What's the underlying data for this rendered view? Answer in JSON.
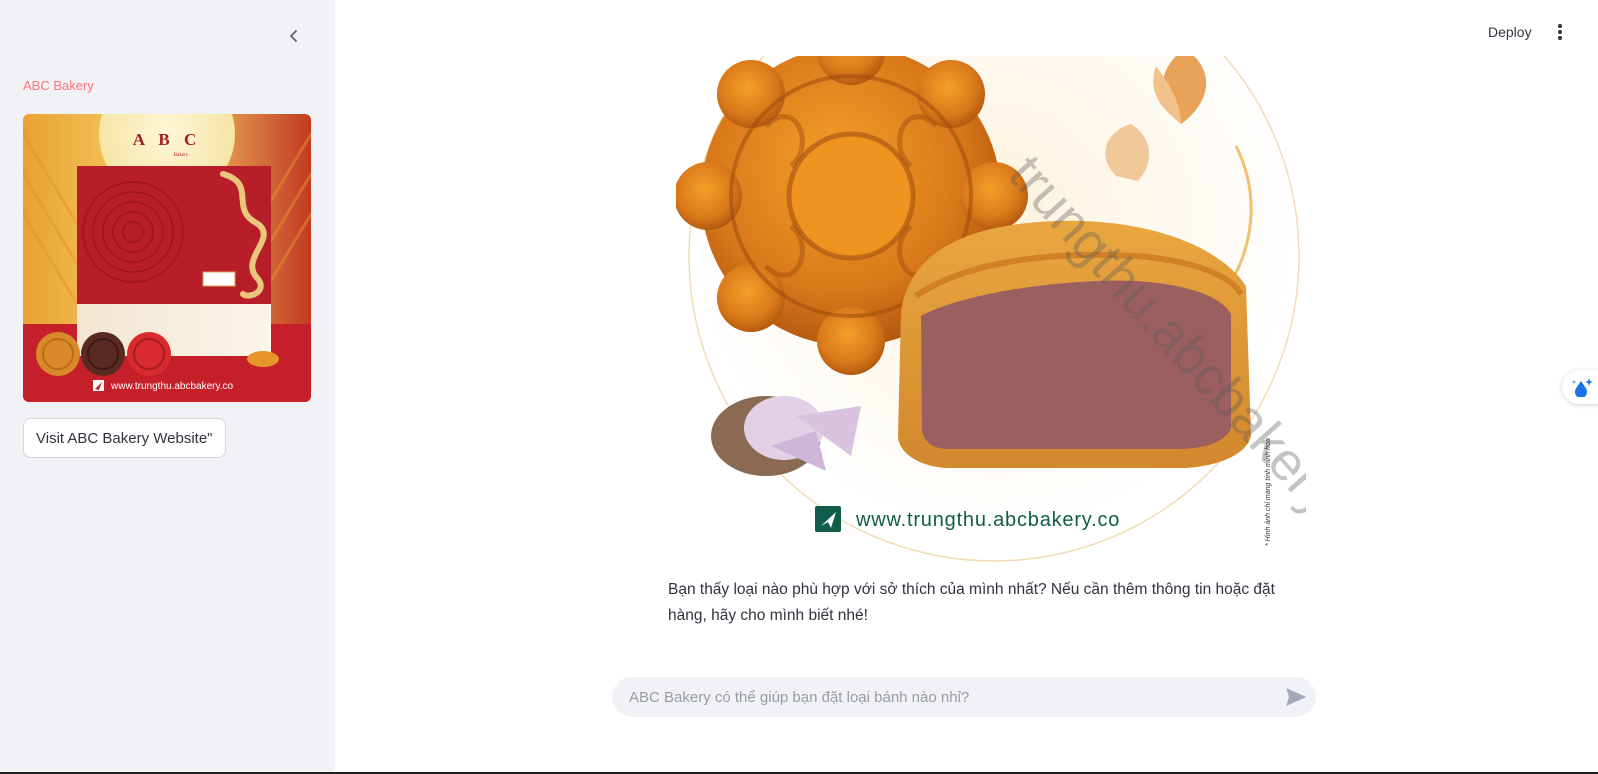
{
  "sidebar": {
    "brand": "ABC Bakery",
    "promo_image": {
      "logo_text": "A B C",
      "logo_sub": "Bakery",
      "url_text": "www.trungthu.abcbakery.co"
    },
    "visit_button": "Visit ABC Bakery Website\""
  },
  "header": {
    "deploy_label": "Deploy"
  },
  "hero_image": {
    "url_text": "www.trungthu.abcbakery.co",
    "watermark": "trungthu.abcbakery.co",
    "disclaimer": "* Hình ảnh chỉ mang tính minh họa"
  },
  "chat": {
    "assistant_message": "Bạn thấy loại nào phù hợp với sở thích của mình nhất? Nếu cần thêm thông tin hoặc đặt hàng, hãy cho mình biết nhé!",
    "input_placeholder": "ABC Bakery có thể giúp bạn đặt loại bánh nào nhỉ?"
  },
  "colors": {
    "accent": "#ff4b4b",
    "sidebar_bg": "#f0f2f6",
    "text": "#31333f",
    "brand_green": "#0f5d4a"
  }
}
